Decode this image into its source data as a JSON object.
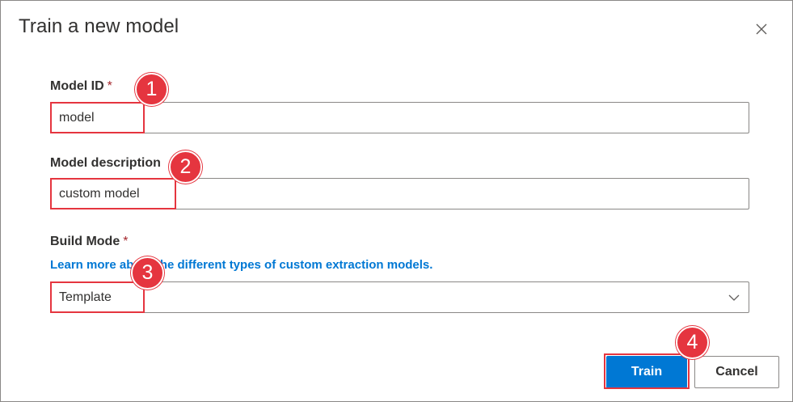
{
  "dialog": {
    "title": "Train a new model",
    "close_icon": "close-icon"
  },
  "fields": {
    "model_id": {
      "label": "Model ID",
      "required_mark": "*",
      "value": "model"
    },
    "model_description": {
      "label": "Model description",
      "value": "custom model"
    },
    "build_mode": {
      "label": "Build Mode",
      "required_mark": "*",
      "link_text": "Learn more about the different types of custom extraction models.",
      "selected": "Template",
      "dropdown_icon": "chevron-down-icon"
    }
  },
  "buttons": {
    "train": "Train",
    "cancel": "Cancel"
  },
  "annotations": {
    "badge_1": "1",
    "badge_2": "2",
    "badge_3": "3",
    "badge_4": "4"
  },
  "colors": {
    "primary": "#0078d4",
    "required": "#a4262c",
    "annotation": "#e5353f",
    "border": "#8a8886",
    "text": "#323130"
  }
}
